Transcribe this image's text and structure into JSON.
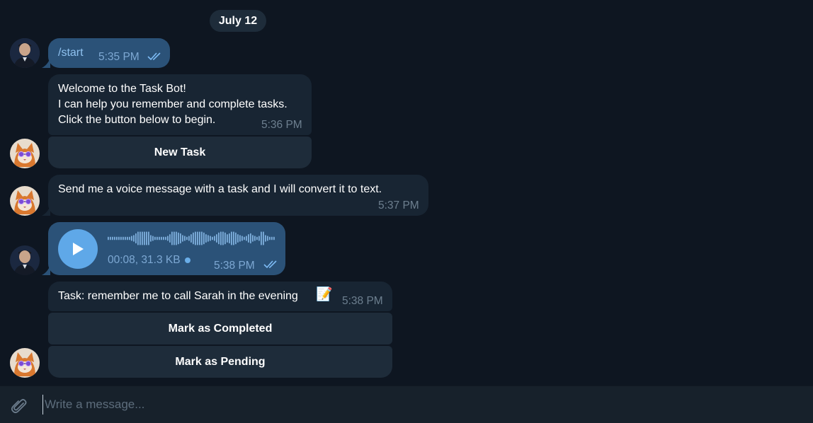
{
  "date_divider": "July 12",
  "messages": [
    {
      "text": "/start",
      "time": "5:35 PM"
    },
    {
      "lines": [
        "Welcome to the Task Bot!",
        "I can help you remember and complete tasks.",
        "Click the button below to begin."
      ],
      "time": "5:36 PM",
      "button": "New Task"
    },
    {
      "text": "Send me a voice message with a task and I will convert it to text.",
      "time": "5:37 PM"
    },
    {
      "voice_meta": "00:08, 31.3 KB",
      "time": "5:38 PM"
    },
    {
      "text": "Task: remember me to call Sarah in the evening",
      "emoji": "📝",
      "time": "5:38 PM",
      "buttons": [
        "Mark as Completed",
        "Mark as Pending"
      ]
    }
  ],
  "composer": {
    "placeholder": "Write a message..."
  },
  "icons": {
    "read_status": "double-check-icon",
    "attach": "paperclip-icon",
    "play": "play-icon",
    "unread_dot": "unread-dot-icon"
  },
  "colors": {
    "background": "#0e1621",
    "outgoing_bubble": "#2b5278",
    "incoming_bubble": "#182533",
    "accent": "#5fa8e8"
  }
}
